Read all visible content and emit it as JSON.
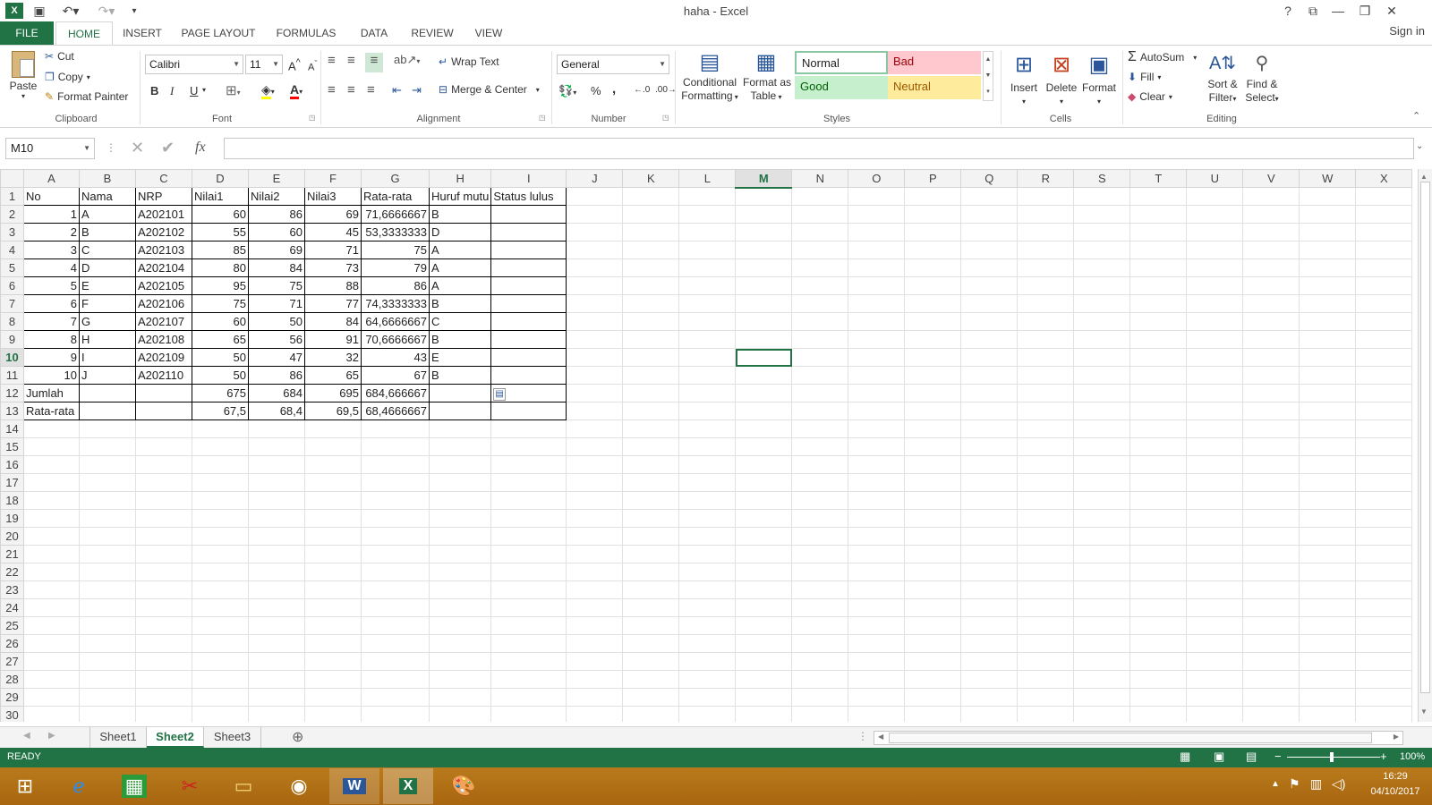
{
  "app": {
    "title": "haha - Excel"
  },
  "window": {
    "help": "?",
    "ribbon_opts": "⧉",
    "minimize": "—",
    "restore": "❐",
    "close": "✕"
  },
  "tabs": [
    "FILE",
    "HOME",
    "INSERT",
    "PAGE LAYOUT",
    "FORMULAS",
    "DATA",
    "REVIEW",
    "VIEW"
  ],
  "signin": "Sign in",
  "clipboard": {
    "paste": "Paste",
    "cut": "Cut",
    "copy": "Copy",
    "format_painter": "Format Painter",
    "label": "Clipboard"
  },
  "font": {
    "name": "Calibri",
    "size": "11",
    "bold": "B",
    "italic": "I",
    "underline": "U",
    "label": "Font"
  },
  "alignment": {
    "wrap": "Wrap Text",
    "merge": "Merge & Center",
    "label": "Alignment"
  },
  "number": {
    "format": "General",
    "percent": "%",
    "comma": ",",
    "label": "Number"
  },
  "styles": {
    "conditional": [
      "Conditional",
      "Formatting"
    ],
    "format_table": [
      "Format as",
      "Table"
    ],
    "normal": "Normal",
    "bad": "Bad",
    "good": "Good",
    "neutral": "Neutral",
    "label": "Styles"
  },
  "cells": {
    "insert": "Insert",
    "delete": "Delete",
    "format": "Format",
    "label": "Cells"
  },
  "editing": {
    "autosum": "AutoSum",
    "fill": "Fill",
    "clear": "Clear",
    "sort": [
      "Sort &",
      "Filter"
    ],
    "find": [
      "Find &",
      "Select"
    ],
    "label": "Editing"
  },
  "formula_bar": {
    "name_box": "M10",
    "fx": "fx",
    "formula": ""
  },
  "grid": {
    "columns": [
      "A",
      "B",
      "C",
      "D",
      "E",
      "F",
      "G",
      "H",
      "I",
      "J",
      "K",
      "L",
      "M",
      "N",
      "O",
      "P",
      "Q",
      "R",
      "S",
      "T",
      "U",
      "V",
      "W",
      "X"
    ],
    "selected_column": "M",
    "selected_row": 10,
    "rows": [
      [
        "No",
        "Nama",
        "NRP",
        "Nilai1",
        "Nilai2",
        "Nilai3",
        "Rata-rata",
        "Huruf mutu",
        "Status lulus"
      ],
      [
        "1",
        "A",
        "A202101",
        "60",
        "86",
        "69",
        "71,6666667",
        "B",
        ""
      ],
      [
        "2",
        "B",
        "A202102",
        "55",
        "60",
        "45",
        "53,3333333",
        "D",
        ""
      ],
      [
        "3",
        "C",
        "A202103",
        "85",
        "69",
        "71",
        "75",
        "A",
        ""
      ],
      [
        "4",
        "D",
        "A202104",
        "80",
        "84",
        "73",
        "79",
        "A",
        ""
      ],
      [
        "5",
        "E",
        "A202105",
        "95",
        "75",
        "88",
        "86",
        "A",
        ""
      ],
      [
        "6",
        "F",
        "A202106",
        "75",
        "71",
        "77",
        "74,3333333",
        "B",
        ""
      ],
      [
        "7",
        "G",
        "A202107",
        "60",
        "50",
        "84",
        "64,6666667",
        "C",
        ""
      ],
      [
        "8",
        "H",
        "A202108",
        "65",
        "56",
        "91",
        "70,6666667",
        "B",
        ""
      ],
      [
        "9",
        "I",
        "A202109",
        "50",
        "47",
        "32",
        "43",
        "E",
        ""
      ],
      [
        "10",
        "J",
        "A202110",
        "50",
        "86",
        "65",
        "67",
        "B",
        ""
      ],
      [
        "Jumlah",
        "",
        "",
        "675",
        "684",
        "695",
        "684,666667",
        "",
        ""
      ],
      [
        "Rata-rata",
        "",
        "",
        "67,5",
        "68,4",
        "69,5",
        "68,4666667",
        "",
        ""
      ]
    ],
    "total_rows": 30
  },
  "sheets": [
    "Sheet1",
    "Sheet2",
    "Sheet3"
  ],
  "active_sheet": "Sheet2",
  "status": {
    "mode": "READY",
    "zoom": "100%"
  },
  "taskbar": {
    "time": "16:29",
    "date": "04/10/2017"
  }
}
